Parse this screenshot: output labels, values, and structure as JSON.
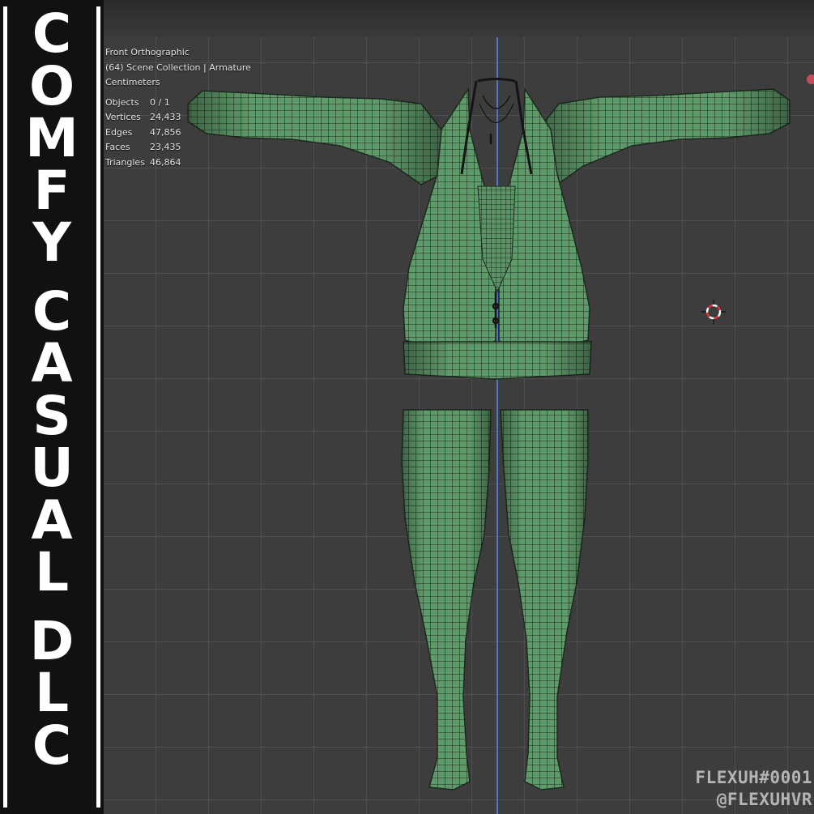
{
  "viewport": {
    "view_name": "Front Orthographic",
    "collection_info": "(64) Scene Collection | Armature",
    "units": "Centimeters",
    "stats": [
      {
        "label": "Objects",
        "value": "0 / 1"
      },
      {
        "label": "Vertices",
        "value": "24,433"
      },
      {
        "label": "Edges",
        "value": "47,856"
      },
      {
        "label": "Faces",
        "value": "23,435"
      },
      {
        "label": "Triangles",
        "value": "46,864"
      }
    ],
    "colors": {
      "grid_background": "#3d3d3d",
      "grid_line": "#4f4f4f",
      "y_axis": "#4f78c0",
      "mesh_fill": "#5f9a6a",
      "mesh_wire": "#1c2a1e",
      "cursor_red": "#d8333a"
    }
  },
  "title_banner": {
    "lines": [
      "C",
      "O",
      "M",
      "F",
      "Y",
      "C",
      "A",
      "S",
      "U",
      "A",
      "L",
      "D",
      "L",
      "C"
    ]
  },
  "watermark": {
    "line1": "FLEXUH#0001",
    "line2": "@FLEXUHVR"
  },
  "icons": {
    "cursor": "3d-cursor-icon",
    "gizmo": "navigation-gizmo-dot-icon"
  }
}
